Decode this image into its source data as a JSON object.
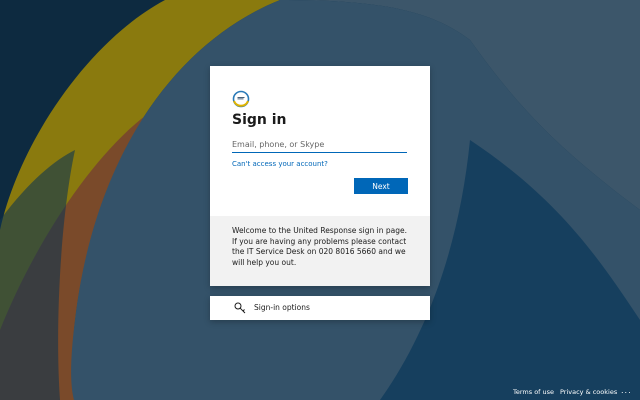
{
  "colors": {
    "accent": "#0067b8",
    "background": "#0f3550",
    "card": "#ffffff",
    "info_panel": "#f2f2f2",
    "shape_yellow": "#8a7a0e",
    "shape_orange": "#7a4a2a",
    "shape_slate": "#345269"
  },
  "logo": {
    "icon": "organization-logo-icon"
  },
  "signin": {
    "title": "Sign in",
    "email_placeholder": "Email, phone, or Skype",
    "email_value": "",
    "cant_access_link": "Can't access your account?",
    "next_button": "Next"
  },
  "welcome": {
    "text": "Welcome to the United Response sign in page. If you are having any problems please contact the IT Service Desk on 020 8016 5660 and we will help you out."
  },
  "signin_options": {
    "label": "Sign-in options",
    "icon": "key-icon"
  },
  "footer": {
    "terms": "Terms of use",
    "privacy": "Privacy & cookies",
    "more": "..."
  }
}
